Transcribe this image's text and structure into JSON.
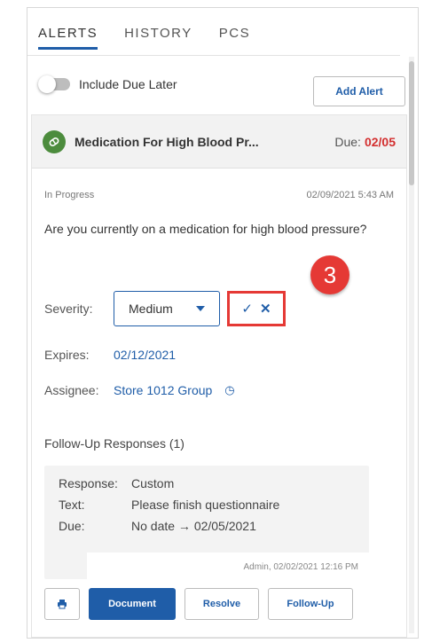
{
  "tabs": [
    {
      "label": "ALERTS",
      "active": true
    },
    {
      "label": "HISTORY",
      "active": false
    },
    {
      "label": "PCS",
      "active": false
    }
  ],
  "toggle": {
    "label": "Include Due Later",
    "on": false
  },
  "add_alert_label": "Add Alert",
  "alert": {
    "icon": "pill-icon",
    "title": "Medication For High Blood Pr...",
    "due_label": "Due:",
    "due_date": "02/05",
    "status": "In Progress",
    "timestamp": "02/09/2021 5:43 AM",
    "question": "Are you currently on a medication for high blood pressure?",
    "severity_label": "Severity:",
    "severity_value": "Medium",
    "expires_label": "Expires:",
    "expires_value": "02/12/2021",
    "assignee_label": "Assignee:",
    "assignee_value": "Store 1012 Group"
  },
  "annotation_badge": "3",
  "followup": {
    "title": "Follow-Up Responses (1)",
    "rows": [
      {
        "key": "Response:",
        "value": "Custom"
      },
      {
        "key": "Text:",
        "value": "Please finish questionnaire"
      },
      {
        "key": "Due:",
        "value": "No date → 02/05/2021"
      }
    ],
    "meta": "Admin, 02/02/2021 12:16 PM"
  },
  "buttons": {
    "document": "Document",
    "resolve": "Resolve",
    "follow_up": "Follow-Up"
  },
  "colors": {
    "accent": "#1f5da8",
    "danger": "#d32f2f",
    "badge": "#e53935",
    "med_icon": "#4c8c3d"
  }
}
